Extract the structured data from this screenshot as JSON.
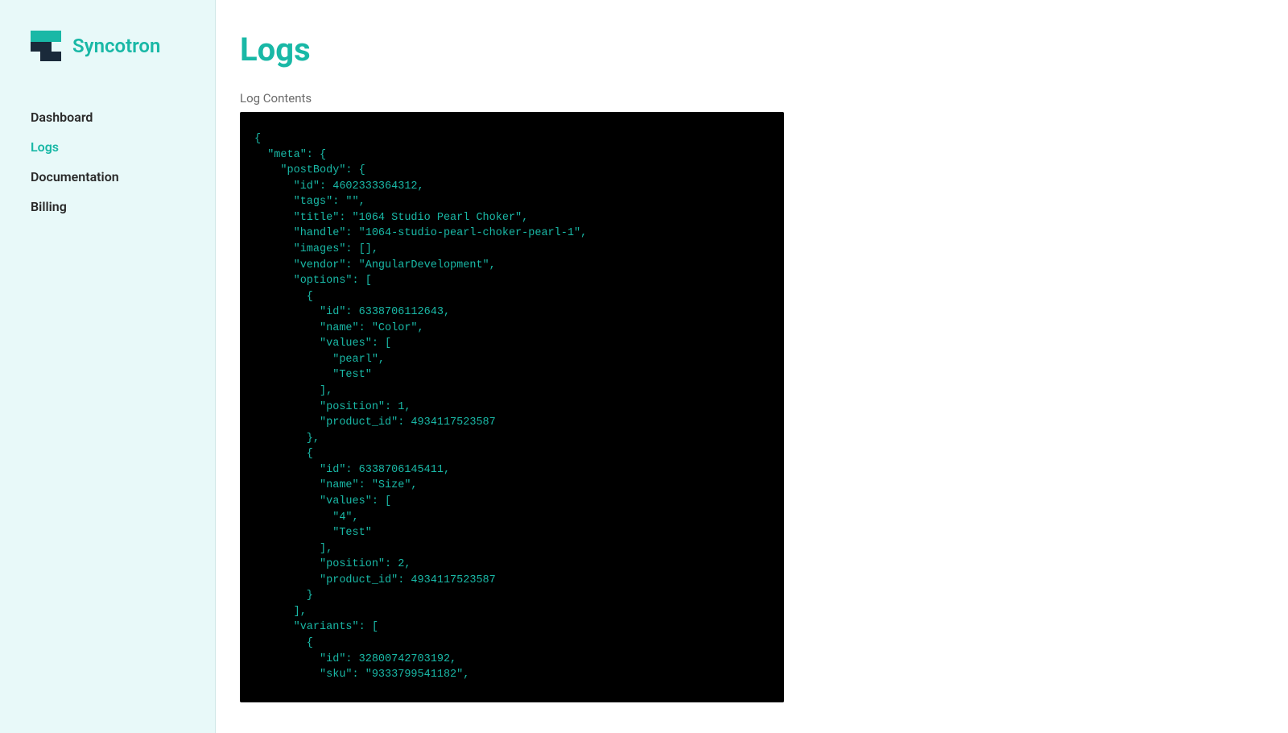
{
  "brand": {
    "name": "Syncotron"
  },
  "sidebar": {
    "items": [
      {
        "label": "Dashboard",
        "active": false
      },
      {
        "label": "Logs",
        "active": true
      },
      {
        "label": "Documentation",
        "active": false
      },
      {
        "label": "Billing",
        "active": false
      }
    ]
  },
  "page": {
    "title": "Logs",
    "section_label": "Log Contents"
  },
  "log": {
    "raw": "{\n  \"meta\": {\n    \"postBody\": {\n      \"id\": 4602333364312,\n      \"tags\": \"\",\n      \"title\": \"1064 Studio Pearl Choker\",\n      \"handle\": \"1064-studio-pearl-choker-pearl-1\",\n      \"images\": [],\n      \"vendor\": \"AngularDevelopment\",\n      \"options\": [\n        {\n          \"id\": 6338706112643,\n          \"name\": \"Color\",\n          \"values\": [\n            \"pearl\",\n            \"Test\"\n          ],\n          \"position\": 1,\n          \"product_id\": 4934117523587\n        },\n        {\n          \"id\": 6338706145411,\n          \"name\": \"Size\",\n          \"values\": [\n            \"4\",\n            \"Test\"\n          ],\n          \"position\": 2,\n          \"product_id\": 4934117523587\n        }\n      ],\n      \"variants\": [\n        {\n          \"id\": 32800742703192,\n          \"sku\": \"9333799541182\","
  }
}
